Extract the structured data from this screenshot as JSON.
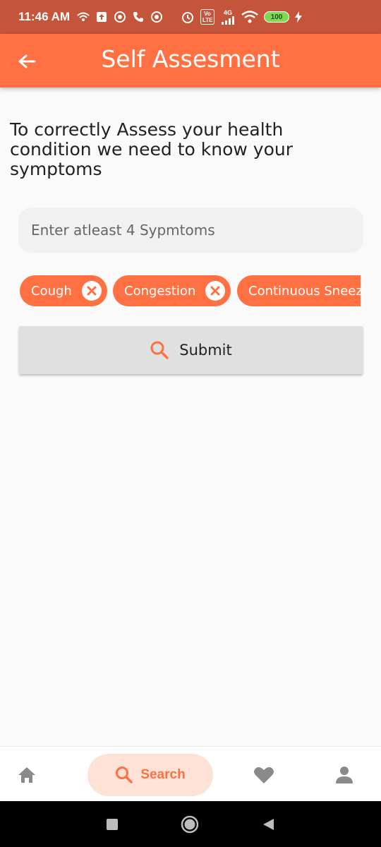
{
  "status_bar": {
    "time": "11:46 AM",
    "network": "4G",
    "volte": "Vo LTE",
    "battery": "100"
  },
  "app_bar": {
    "title": "Self Assesment",
    "back_icon": "arrow-left-icon"
  },
  "intro_text": "To correctly Assess your health condition we need to know your symptoms",
  "symptom_input": {
    "value": "",
    "placeholder": "Enter atleast 4 Sypmtoms"
  },
  "chips": [
    {
      "label": "Cough"
    },
    {
      "label": "Congestion"
    },
    {
      "label": "Continuous Sneezing"
    }
  ],
  "submit": {
    "label": "Submit",
    "icon": "search-icon"
  },
  "bottom_nav": {
    "items": [
      {
        "icon": "home-icon",
        "label": ""
      },
      {
        "icon": "search-icon",
        "label": "Search",
        "active": true
      },
      {
        "icon": "heart-icon",
        "label": ""
      },
      {
        "icon": "person-icon",
        "label": ""
      }
    ]
  },
  "colors": {
    "accent": "#ff7043",
    "status_bar": "#c4553a",
    "search_pill": "#ffe2d6",
    "nav_icon": "#8a8a8a"
  }
}
